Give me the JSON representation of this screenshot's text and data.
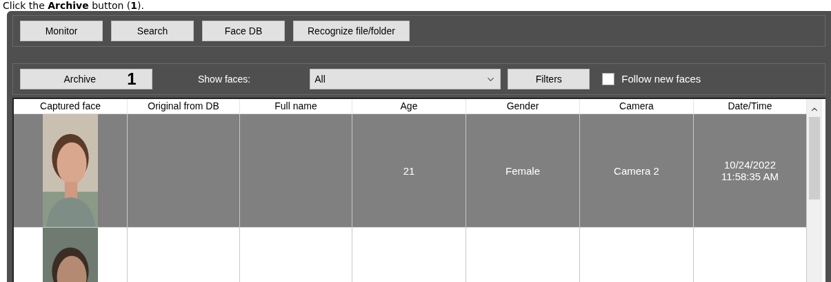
{
  "caption": "Click the **Archive** button (**1**).",
  "nav_buttons": [
    "Monitor",
    "Search",
    "Face DB",
    "Recognize file/folder"
  ],
  "archive_button": {
    "label": "Archive",
    "callout": "1"
  },
  "show_faces": {
    "label": "Show faces:",
    "value": "All"
  },
  "filters_button": "Filters",
  "follow_new_faces": {
    "label": "Follow new faces",
    "checked": false
  },
  "table": {
    "columns": [
      "Captured face",
      "Original from DB",
      "Full name",
      "Age",
      "Gender",
      "Camera",
      "Date/Time"
    ],
    "rows": [
      {
        "selected": true,
        "age": "21",
        "gender": "Female",
        "camera": "Camera 2",
        "date_time": "10/24/2022 11:58:35 AM"
      },
      {
        "selected": false
      }
    ]
  }
}
